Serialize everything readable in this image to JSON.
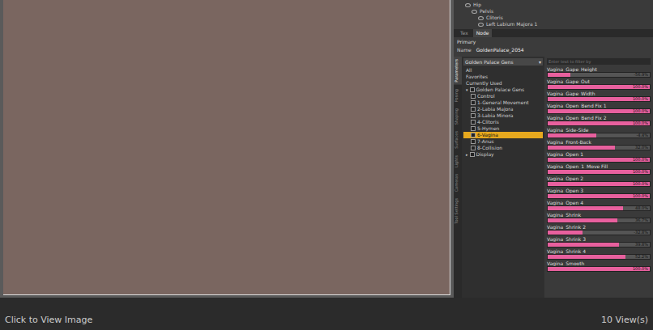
{
  "scene_tree": [
    {
      "label": "Hip",
      "depth": 0
    },
    {
      "label": "Pelvis",
      "depth": 1
    },
    {
      "label": "Clitoris",
      "depth": 2
    },
    {
      "label": "Left Labium Majora 1",
      "depth": 2
    }
  ],
  "tabs": [
    {
      "label": "Tex",
      "selected": false
    },
    {
      "label": "Node",
      "selected": true
    }
  ],
  "section": "Primary",
  "name_field": {
    "label": "Name",
    "value": "GoldenPalace_2054"
  },
  "side_tabs": [
    {
      "label": "Parameters",
      "selected": true
    },
    {
      "label": "Posing",
      "selected": false
    },
    {
      "label": "Shaping",
      "selected": false
    },
    {
      "label": "Surfaces",
      "selected": false
    },
    {
      "label": "Lights",
      "selected": false
    },
    {
      "label": "Cameras",
      "selected": false
    },
    {
      "label": "Tool Settings",
      "selected": false
    }
  ],
  "category_dropdown": {
    "value": "Golden Palace Gens",
    "arrow": "▾"
  },
  "categories": [
    {
      "label": "All",
      "kind": "plain",
      "depth": 0,
      "selected": false,
      "checked": false,
      "toggle": ""
    },
    {
      "label": "Favorites",
      "kind": "plain",
      "depth": 0,
      "selected": false,
      "checked": false,
      "toggle": ""
    },
    {
      "label": "Currently Used",
      "kind": "plain",
      "depth": 0,
      "selected": false,
      "checked": false,
      "toggle": ""
    },
    {
      "label": "Golden Palace Gens",
      "kind": "group",
      "depth": 0,
      "selected": false,
      "checked": false,
      "toggle": "▾"
    },
    {
      "label": "Control",
      "kind": "check",
      "depth": 1,
      "selected": false,
      "checked": false,
      "toggle": ""
    },
    {
      "label": "1-General Movement",
      "kind": "check",
      "depth": 1,
      "selected": false,
      "checked": false,
      "toggle": ""
    },
    {
      "label": "2-Labia Majora",
      "kind": "check",
      "depth": 1,
      "selected": false,
      "checked": false,
      "toggle": ""
    },
    {
      "label": "3-Labia Minora",
      "kind": "check",
      "depth": 1,
      "selected": false,
      "checked": false,
      "toggle": ""
    },
    {
      "label": "4-Clitoris",
      "kind": "check",
      "depth": 1,
      "selected": false,
      "checked": false,
      "toggle": ""
    },
    {
      "label": "5-Hymen",
      "kind": "check",
      "depth": 1,
      "selected": false,
      "checked": false,
      "toggle": ""
    },
    {
      "label": "6-Vagina",
      "kind": "check",
      "depth": 1,
      "selected": true,
      "checked": false,
      "toggle": ""
    },
    {
      "label": "7-Anus",
      "kind": "check",
      "depth": 1,
      "selected": false,
      "checked": false,
      "toggle": ""
    },
    {
      "label": "8-Collision",
      "kind": "check",
      "depth": 1,
      "selected": false,
      "checked": false,
      "toggle": ""
    },
    {
      "label": "Display",
      "kind": "check",
      "depth": 0,
      "selected": false,
      "checked": false,
      "toggle": "▸"
    }
  ],
  "search": {
    "placeholder": "Enter text to filter by"
  },
  "sliders": [
    {
      "name": "Vagina_Gape_Height",
      "reading": "-56.9%",
      "level": 0.22
    },
    {
      "name": "Vagina_Gape_Out",
      "reading": "100.0%",
      "level": 1
    },
    {
      "name": "Vagina_Gape_Width",
      "reading": "100.0%",
      "level": 1
    },
    {
      "name": "Vagina_Open_Bend Fix 1",
      "reading": "100.0%",
      "level": 1
    },
    {
      "name": "Vagina_Open_Bend Fix 2",
      "reading": "100.0%",
      "level": 1
    },
    {
      "name": "Vagina_Side-Side",
      "reading": "-4.4%",
      "level": 0.48
    },
    {
      "name": "Vagina_Front-Back",
      "reading": "32.0%",
      "level": 0.66
    },
    {
      "name": "Vagina_Open 1",
      "reading": "100.0%",
      "level": 1
    },
    {
      "name": "Vagina_Open_1_Move Fill",
      "reading": "100.0%",
      "level": 1
    },
    {
      "name": "Vagina_Open 2",
      "reading": "100.0%",
      "level": 1
    },
    {
      "name": "Vagina_Open 3",
      "reading": "100.0%",
      "level": 1
    },
    {
      "name": "Vagina_Open 4",
      "reading": "48.0%",
      "level": 0.74
    },
    {
      "name": "Vagina_Shrink",
      "reading": "36.7%",
      "level": 0.68
    },
    {
      "name": "Vagina_Shrink 2",
      "reading": "-32.8%",
      "level": 0.34
    },
    {
      "name": "Vagina_Shrink 3",
      "reading": "39.8%",
      "level": 0.7
    },
    {
      "name": "Vagina_Shrink 4",
      "reading": "52.2%",
      "level": 0.76
    },
    {
      "name": "Vagina_Smooth",
      "reading": "100.0%",
      "level": 1
    }
  ],
  "footer": {
    "caption": "Click to View Image",
    "views": "10 View(s)"
  }
}
